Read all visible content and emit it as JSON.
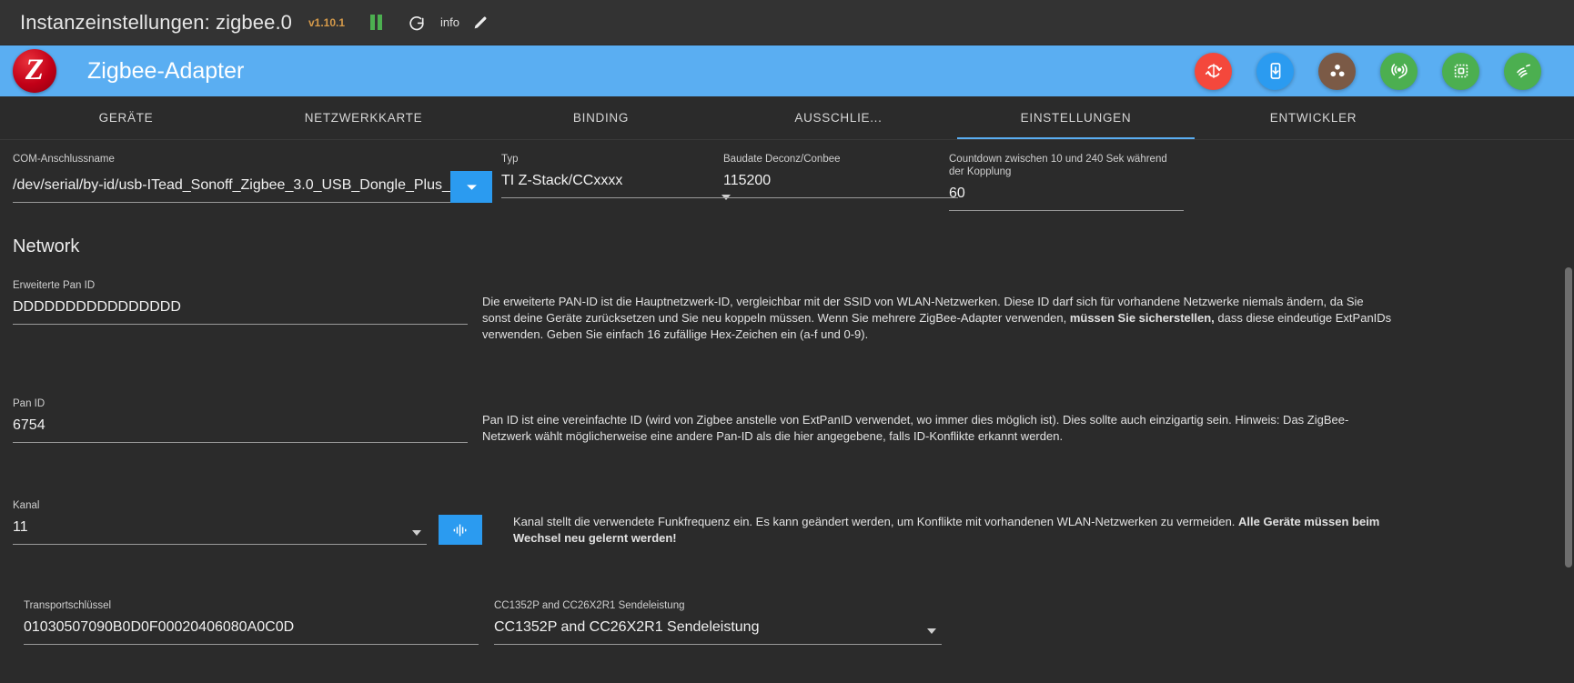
{
  "titlebar": {
    "title": "Instanzeinstellungen: zigbee.0",
    "version": "v1.10.1",
    "pause_icon": "pause-icon",
    "refresh_icon": "refresh-icon",
    "info_label": "info",
    "edit_icon": "pencil-icon"
  },
  "appbar": {
    "logo_letter": "Z",
    "title": "Zigbee-Adapter",
    "actions": [
      {
        "name": "reset-icon",
        "color": "#f4483c"
      },
      {
        "name": "download-icon",
        "color": "#2b9bf0"
      },
      {
        "name": "group-icon",
        "color": "#7b5a46"
      },
      {
        "name": "broadcast-icon",
        "color": "#4caf50"
      },
      {
        "name": "chip-icon",
        "color": "#4caf50"
      },
      {
        "name": "signal-icon",
        "color": "#4caf50"
      }
    ]
  },
  "tabs": [
    {
      "label": "GERÄTE",
      "active": false
    },
    {
      "label": "NETZWERKKARTE",
      "active": false
    },
    {
      "label": "BINDING",
      "active": false
    },
    {
      "label": "AUSSCHLIE...",
      "active": false
    },
    {
      "label": "EINSTELLUNGEN",
      "active": true
    },
    {
      "label": "ENTWICKLER",
      "active": false
    }
  ],
  "form": {
    "com_port": {
      "label": "COM-Anschlussname",
      "value": "/dev/serial/by-id/usb-ITead_Sonoff_Zigbee_3.0_USB_Dongle_Plus_"
    },
    "typ": {
      "label": "Typ",
      "value": "TI Z-Stack/CCxxxx"
    },
    "baudrate": {
      "label": "Baudate Deconz/Conbee",
      "value": "115200"
    },
    "countdown": {
      "label": "Countdown zwischen 10 und 240 Sek während\nder Kopplung",
      "value": "60"
    },
    "network_section": "Network",
    "ext_pan_id": {
      "label": "Erweiterte Pan ID",
      "value": "DDDDDDDDDDDDDDDD",
      "desc_part1": "Die erweiterte PAN-ID ist die Hauptnetzwerk-ID, vergleichbar mit der SSID von WLAN-Netzwerken. Diese ID darf sich für vorhandene Netzwerke niemals ändern, da Sie sonst deine Geräte zurücksetzen und Sie neu koppeln müssen. Wenn Sie mehrere ZigBee-Adapter verwenden, ",
      "desc_bold": "müssen Sie sicherstellen,",
      "desc_part2": " dass diese eindeutige ExtPanIDs verwenden. Geben Sie einfach 16 zufällige Hex-Zeichen ein (a-f und 0-9)."
    },
    "pan_id": {
      "label": "Pan ID",
      "value": "6754",
      "desc": "Pan ID ist eine vereinfachte ID (wird von Zigbee anstelle von ExtPanID verwendet, wo immer dies möglich ist). Dies sollte auch einzigartig sein. Hinweis: Das ZigBee-Netzwerk wählt möglicherweise eine andere Pan-ID als die hier angegebene, falls ID-Konflikte erkannt werden."
    },
    "kanal": {
      "label": "Kanal",
      "value": "11",
      "scan_icon": "signal-bars-icon",
      "desc_part1": "Kanal stellt die verwendete Funkfrequenz ein. Es kann geändert werden, um Konflikte mit vorhandenen WLAN-Netzwerken zu vermeiden. ",
      "desc_bold": "Alle Geräte müssen beim Wechsel neu gelernt werden!"
    },
    "transport_key": {
      "label": "Transportschlüssel",
      "value": "01030507090B0D0F00020406080A0C0D"
    },
    "tx_power": {
      "label": "CC1352P and CC26X2R1 Sendeleistung",
      "value": "CC1352P and CC26X2R1 Sendeleistung"
    }
  }
}
